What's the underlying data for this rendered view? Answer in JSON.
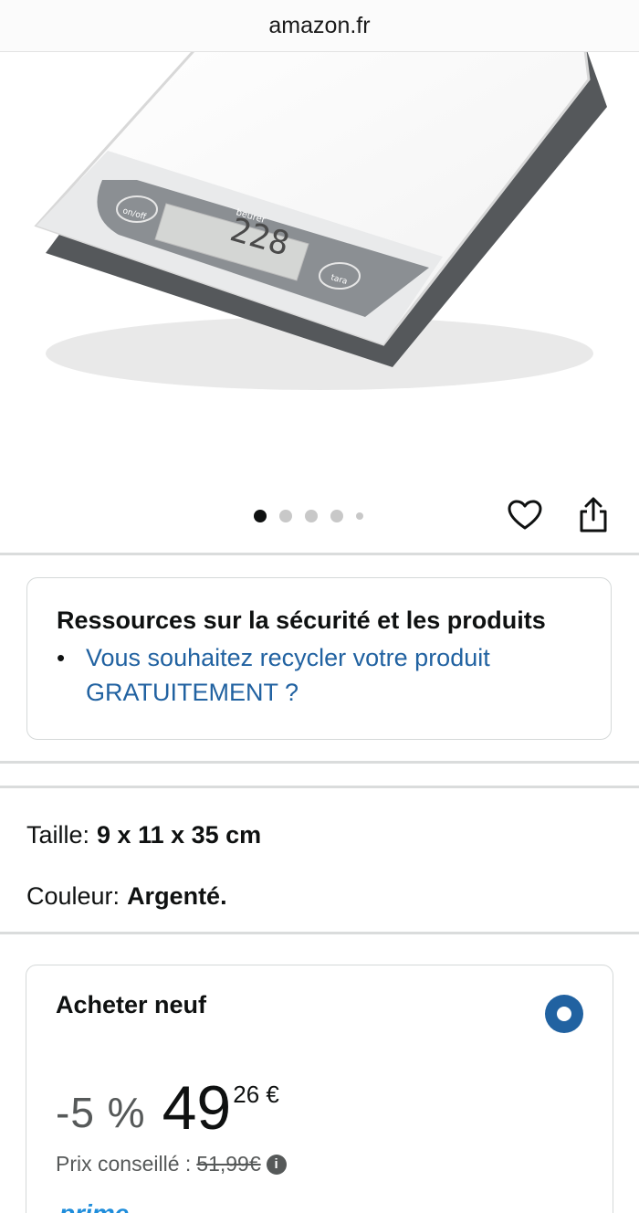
{
  "browser": {
    "url": "amazon.fr"
  },
  "gallery": {
    "dot_count": 5,
    "active_index": 0
  },
  "scale": {
    "brand": "beurer",
    "display_value": "228",
    "button_left": "on/off",
    "button_right": "tara"
  },
  "safety": {
    "title": "Ressources sur la sécurité et les produits",
    "link": "Vous souhaitez recycler votre produit GRATUITEMENT ?"
  },
  "attributes": {
    "size_label": "Taille:",
    "size_value": "9 x 11 x 35 cm",
    "color_label": "Couleur:",
    "color_value": "Argenté."
  },
  "buy_box": {
    "title": "Acheter neuf",
    "discount": "-5 %",
    "price_whole": "49",
    "price_fraction": "26 €",
    "list_price_label": "Prix conseillé :",
    "list_price_value": "51,99€",
    "prime_label": "prime"
  },
  "colors": {
    "link": "#2162a1",
    "accent": "#2162a1"
  }
}
